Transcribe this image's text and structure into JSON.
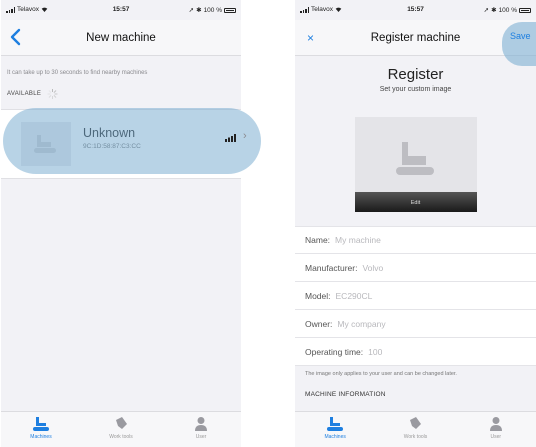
{
  "phone_a": {
    "status": {
      "carrier": "Telavox",
      "time": "15:57",
      "battery": "100 %"
    },
    "nav": {
      "title": "New machine"
    },
    "hint": "It can take up to 30 seconds to find nearby machines",
    "available_label": "AVAILABLE",
    "machines": [
      {
        "name": "Unknown",
        "mac": "9C:1D:58:87:C3:CC"
      }
    ],
    "tabs": [
      {
        "label": "Machines",
        "icon": "excavator-icon",
        "active": true
      },
      {
        "label": "Work tools",
        "icon": "bucket-icon",
        "active": false
      },
      {
        "label": "User",
        "icon": "user-icon",
        "active": false
      }
    ]
  },
  "phone_b": {
    "status": {
      "carrier": "Telavox",
      "time": "15:57",
      "battery": "100 %"
    },
    "nav": {
      "close": "×",
      "title": "Register machine",
      "save": "Save"
    },
    "heading": "Register",
    "subheading": "Set your custom image",
    "image_edit_label": "Edit",
    "fields": [
      {
        "label": "Name:",
        "placeholder": "My machine"
      },
      {
        "label": "Manufacturer:",
        "placeholder": "Volvo"
      },
      {
        "label": "Model:",
        "placeholder": "EC290CL"
      },
      {
        "label": "Owner:",
        "placeholder": "My company"
      },
      {
        "label": "Operating time:",
        "placeholder": "100"
      }
    ],
    "note": "The image only applies to your user and can be changed later.",
    "section_header": "MACHINE INFORMATION",
    "tabs": [
      {
        "label": "Machines",
        "icon": "excavator-icon",
        "active": true
      },
      {
        "label": "Work tools",
        "icon": "bucket-icon",
        "active": false
      },
      {
        "label": "User",
        "icon": "user-icon",
        "active": false
      }
    ]
  },
  "colors": {
    "accent": "#1e7fe0",
    "highlight": "#7dafd2"
  }
}
